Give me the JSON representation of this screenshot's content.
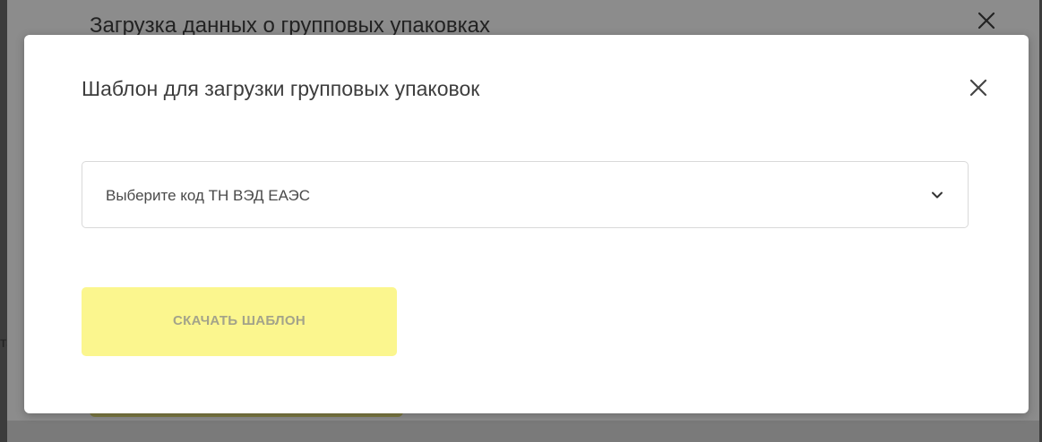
{
  "background_dialog": {
    "title": "Загрузка данных о групповых упаковках",
    "close_icon": "close-icon",
    "side_text_fragment": "та"
  },
  "dialog": {
    "title": "Шаблон для загрузки групповых упаковок",
    "close_icon": "close-icon",
    "select": {
      "placeholder": "Выберите код ТН ВЭД ЕАЭС",
      "icon": "chevron-down-icon"
    },
    "download_button_label": "СКАЧАТЬ ШАБЛОН"
  },
  "colors": {
    "overlay": "#8c8c8c",
    "modal_background": "#ffffff",
    "button_background": "#fbf68e",
    "button_text": "#a3a38a",
    "title_text": "#3d3d3d"
  }
}
